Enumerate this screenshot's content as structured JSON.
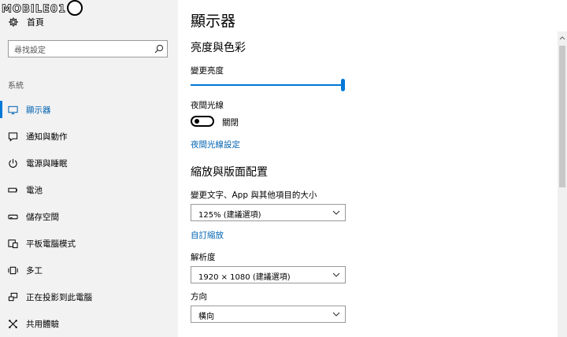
{
  "watermark": {
    "text": "MOBILE01"
  },
  "sidebar": {
    "home_label": "首頁",
    "search_placeholder": "尋找設定",
    "section_label": "系統",
    "items": [
      {
        "label": "顯示器",
        "icon": "monitor-icon",
        "active": true
      },
      {
        "label": "通知與動作",
        "icon": "notification-icon",
        "active": false
      },
      {
        "label": "電源與睡眠",
        "icon": "power-icon",
        "active": false
      },
      {
        "label": "電池",
        "icon": "battery-icon",
        "active": false
      },
      {
        "label": "儲存空間",
        "icon": "storage-icon",
        "active": false
      },
      {
        "label": "平板電腦模式",
        "icon": "tablet-mode-icon",
        "active": false
      },
      {
        "label": "多工",
        "icon": "multitasking-icon",
        "active": false
      },
      {
        "label": "正在投影到此電腦",
        "icon": "projecting-icon",
        "active": false
      },
      {
        "label": "共用體驗",
        "icon": "shared-experiences-icon",
        "active": false
      }
    ]
  },
  "main": {
    "title": "顯示器",
    "brightness_section": "亮度與色彩",
    "brightness_label": "變更亮度",
    "brightness_level": 1.0,
    "night_light_label": "夜間光線",
    "night_light_state": "關閉",
    "night_light_settings_link": "夜間光線設定",
    "scale_section": "縮放與版面配置",
    "text_size_label": "變更文字、App 與其他項目的大小",
    "scale_value": "125% (建議選項)",
    "custom_scale_link": "自訂縮放",
    "resolution_label": "解析度",
    "resolution_value": "1920 × 1080 (建議選項)",
    "orientation_label": "方向",
    "orientation_value": "橫向"
  },
  "colors": {
    "accent": "#0078d7",
    "link": "#0063b1",
    "sidebar_bg": "#f2f2f2"
  }
}
